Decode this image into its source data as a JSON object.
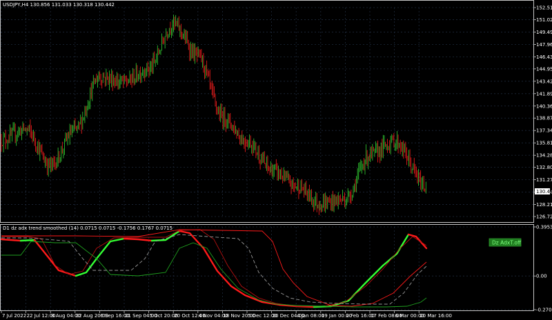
{
  "main_header": "USDJPY,H4  130.856 131.033 130.318 130.442",
  "price_axis_labels": [
    "152.510",
    "151.025",
    "149.495",
    "147.965",
    "146.435",
    "144.950",
    "143.420",
    "141.890",
    "140.360",
    "138.875",
    "137.345",
    "135.815",
    "134.285",
    "132.800",
    "131.270",
    "129.740",
    "128.210",
    "126.725"
  ],
  "current_price": "130.442",
  "sub_header": "D1 dz adx trend smoothed (14) 0.0715 0.0715 -0.1756 0.1767 0.0715",
  "sub_axis_labels": [
    "0.3953",
    "0.00",
    "-0.2709"
  ],
  "sub_badge": "Dz AdxT.off",
  "time_axis_labels": [
    "7 Jul 2022",
    "22 Jul 12:00",
    "8 Aug 04:00",
    "22 Aug 20:00",
    "6 Sep 16:00",
    "21 Sep 04:00",
    "5 Oct 20:00",
    "20 Oct 12:00",
    "4 Nov 04:00",
    "18 Nov 20:00",
    "5 Dec 12:00",
    "20 Dec 04:00",
    "4 Jan 08:00",
    "19 Jan 00:00",
    "2 Feb 16:00",
    "17 Feb 08:00",
    "6 Mar 00:00",
    "20 Mar 16:00"
  ],
  "colors": {
    "background": "#000000",
    "grid": "#1e2a3c",
    "bull_candle": "#2ebd2e",
    "bear_candle": "#e31b1b",
    "line_green": "#33ff33",
    "line_red": "#ff1a1a",
    "dark_red": "#b31010",
    "dark_green": "#1fa01f",
    "dashed": "#9a9a9a",
    "badge_bg": "#1e7a1e",
    "badge_text": "#7dff7d"
  },
  "chart_data": [
    {
      "type": "candlestick",
      "symbol": "USDJPY",
      "timeframe": "H4",
      "ohlc_last": {
        "open": 130.856,
        "high": 131.033,
        "low": 130.318,
        "close": 130.442
      },
      "x_range": [
        "7 Jul 2022",
        "20 Mar 16:00"
      ],
      "ylim": [
        126.725,
        152.51
      ],
      "close_path": [
        {
          "x": "7 Jul 2022",
          "y": 136.2
        },
        {
          "x": "22 Jul 12:00",
          "y": 137.5
        },
        {
          "x": "8 Aug 04:00",
          "y": 133.0
        },
        {
          "x": "22 Aug 20:00",
          "y": 137.4
        },
        {
          "x": "6 Sep 16:00",
          "y": 144.0
        },
        {
          "x": "21 Sep 04:00",
          "y": 143.3
        },
        {
          "x": "5 Oct 20:00",
          "y": 145.0
        },
        {
          "x": "20 Oct 12:00",
          "y": 150.5
        },
        {
          "x": "4 Nov 04:00",
          "y": 146.5
        },
        {
          "x": "18 Nov 20:00",
          "y": 139.0
        },
        {
          "x": "5 Dec 12:00",
          "y": 136.0
        },
        {
          "x": "20 Dec 04:00",
          "y": 132.5
        },
        {
          "x": "4 Jan 08:00",
          "y": 130.5
        },
        {
          "x": "19 Jan 00:00",
          "y": 128.3
        },
        {
          "x": "2 Feb 16:00",
          "y": 128.9
        },
        {
          "x": "17 Feb 08:00",
          "y": 134.3
        },
        {
          "x": "6 Mar 00:00",
          "y": 136.0
        },
        {
          "x": "20 Mar 16:00",
          "y": 130.442
        }
      ]
    },
    {
      "type": "line",
      "title": "D1 dz adx trend smoothed (14)",
      "values_header": [
        0.0715,
        0.0715,
        -0.1756,
        0.1767,
        0.0715
      ],
      "ylim": [
        -0.2709,
        0.3953
      ]
    }
  ]
}
